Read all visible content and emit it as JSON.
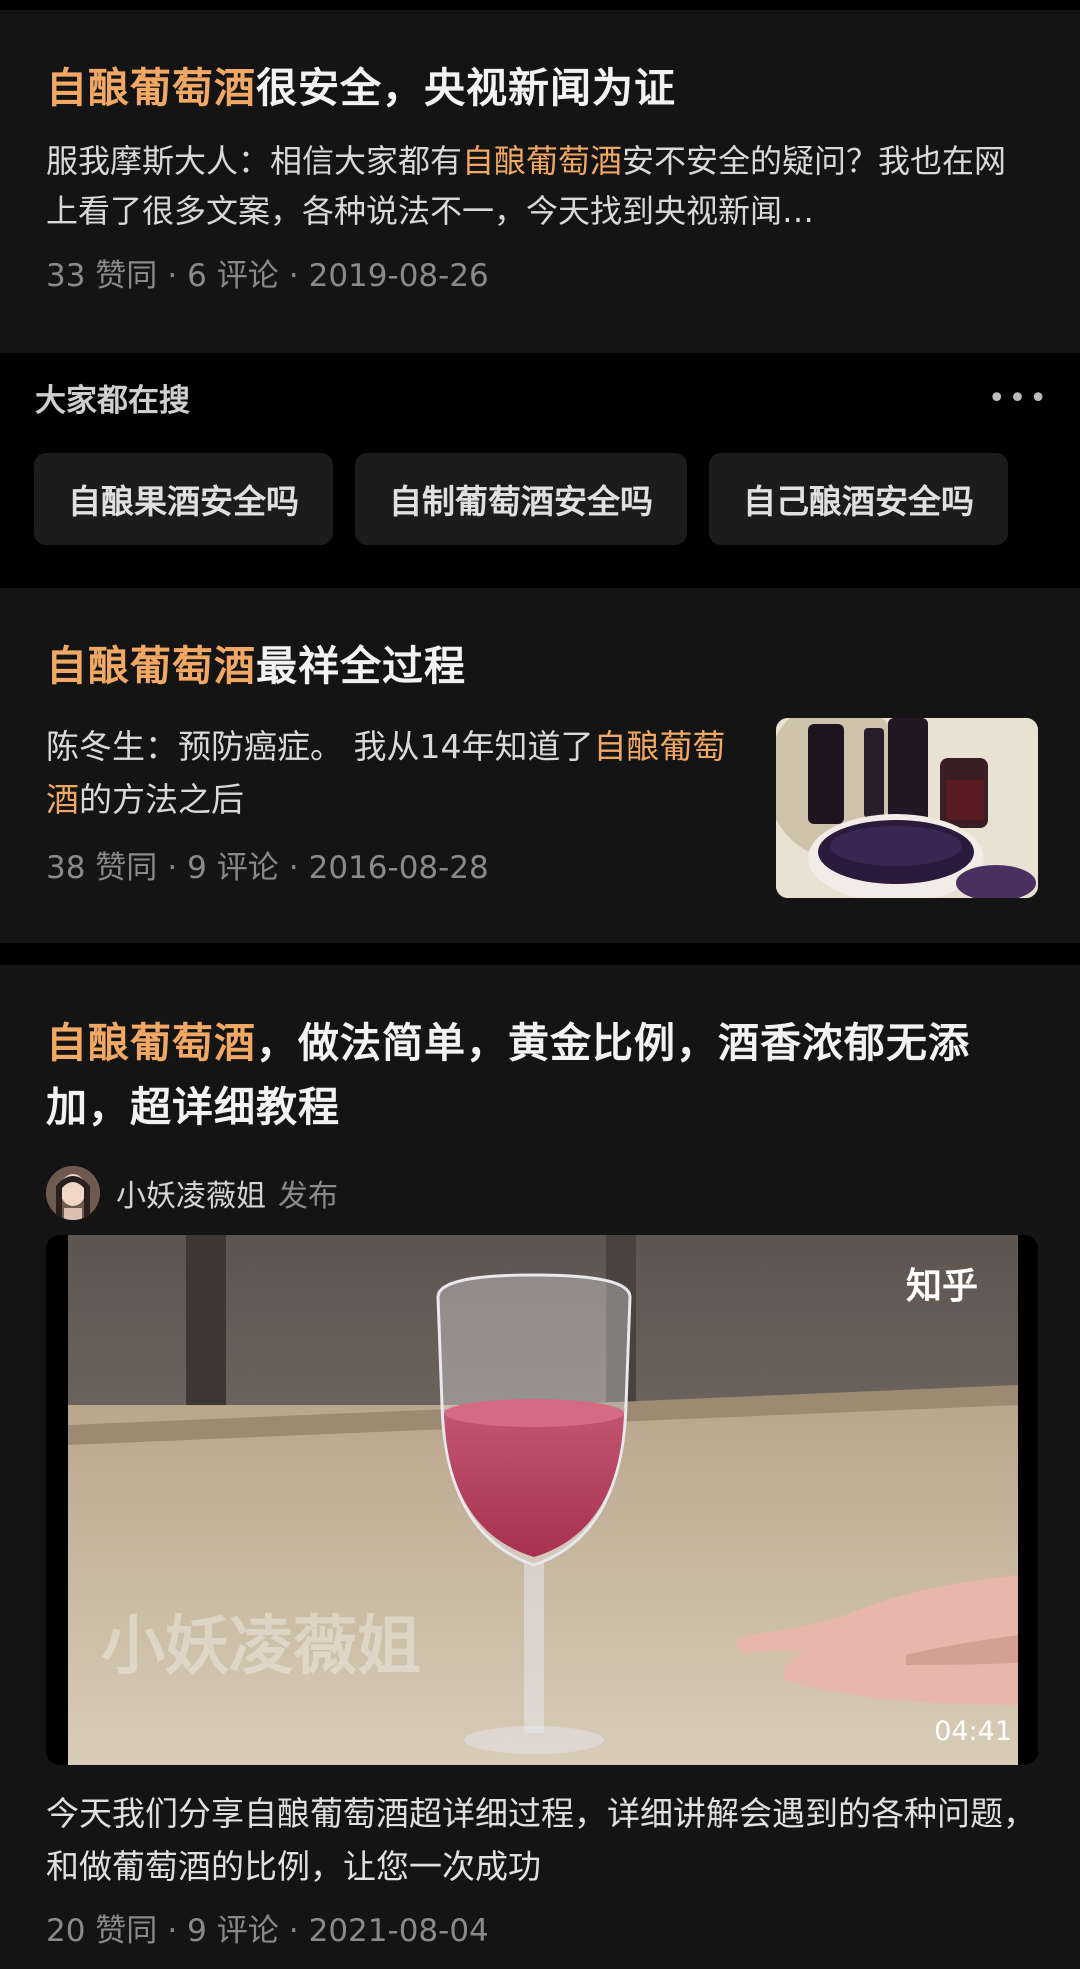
{
  "card1": {
    "title_highlight": "自酿葡萄酒",
    "title_rest": "很安全，央视新闻为证",
    "excerpt_before": "服我摩斯大人：相信大家都有",
    "excerpt_highlight": "自酿葡萄酒",
    "excerpt_after": "安不安全的疑问？我也在网上看了很多文案，各种说法不一，今天找到央视新闻…",
    "likes": "33 赞同",
    "comments": "6 评论",
    "date": "2019-08-26"
  },
  "search": {
    "title": "大家都在搜",
    "more": "•••",
    "chips": [
      "自酿果酒安全吗",
      "自制葡萄酒安全吗",
      "自己酿酒安全吗"
    ]
  },
  "card2": {
    "title_highlight": "自酿葡萄酒",
    "title_rest": "最祥全过程",
    "excerpt_before": "陈冬生：预防癌症。 我从14年知道了",
    "excerpt_highlight": "自酿葡萄酒",
    "excerpt_after": "的方法之后",
    "likes": "38 赞同",
    "comments": "9 评论",
    "date": "2016-08-28"
  },
  "card3": {
    "title_highlight": "自酿葡萄酒",
    "title_rest": "，做法简单，黄金比例，酒香浓郁无添加，超详细教程",
    "author": "小妖凌薇姐",
    "author_action": "发布",
    "video_logo": "知乎",
    "video_watermark": "小妖凌薇姐",
    "video_duration": "04:41",
    "description": "今天我们分享自酿葡萄酒超详细过程，详细讲解会遇到的各种问题，和做葡萄酒的比例，让您一次成功",
    "likes": "20 赞同",
    "comments": "9 评论",
    "date": "2021-08-04"
  },
  "colors": {
    "highlight": "#f0a864",
    "card_bg": "#141414",
    "page_bg": "#000000"
  }
}
